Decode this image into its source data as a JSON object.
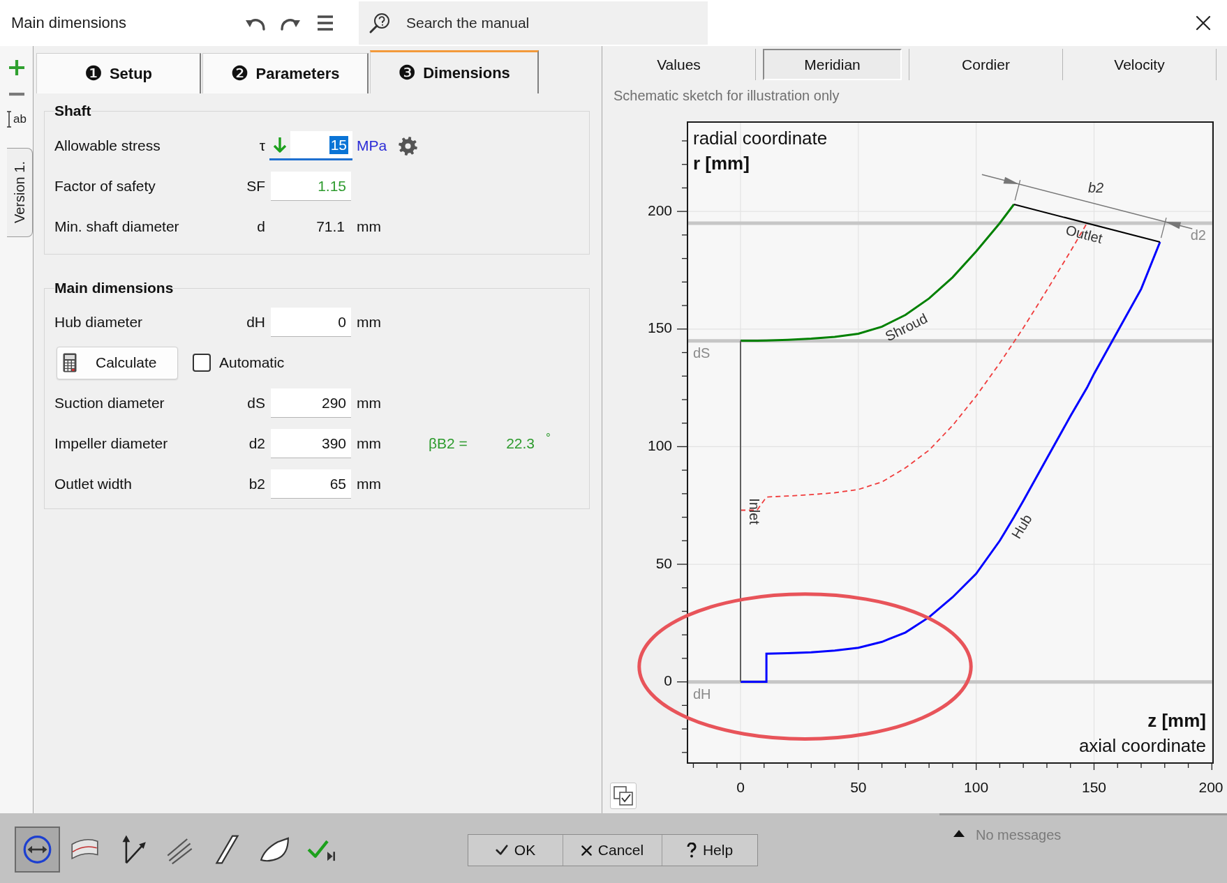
{
  "window": {
    "title": "Main dimensions",
    "search": {
      "placeholder": "Search the manual"
    }
  },
  "side_tools": [
    {
      "kind": "add"
    },
    {
      "kind": "remove"
    },
    {
      "kind": "rename",
      "label": "ab"
    }
  ],
  "version_tab": {
    "label": "Version 1."
  },
  "steps": [
    {
      "number": "❶",
      "label": "Setup",
      "selected": false
    },
    {
      "number": "❷",
      "label": "Parameters",
      "selected": false
    },
    {
      "number": "❸",
      "label": "Dimensions",
      "selected": true
    }
  ],
  "shaft": {
    "title": "Shaft",
    "rows": [
      {
        "kind": "stress",
        "label": "Allowable stress",
        "symbol": "τ",
        "value": "15",
        "unit": "MPa",
        "focused": true
      },
      {
        "kind": "input",
        "label": "Factor of safety",
        "symbol": "SF",
        "value": "1.15",
        "color": "#2e9b2e"
      },
      {
        "kind": "readout",
        "label": "Min. shaft diameter",
        "symbol": "d",
        "value": "71.1",
        "unit": "mm",
        "color": "#111111"
      }
    ]
  },
  "main_dimensions": {
    "title": "Main dimensions",
    "rows": [
      {
        "kind": "input",
        "label": "Hub diameter",
        "symbol": "dH",
        "value": "0",
        "unit": "mm",
        "color": "#111111"
      },
      {
        "kind": "action",
        "button": "Calculate",
        "checkbox": {
          "label": "Automatic",
          "checked": false
        }
      },
      {
        "kind": "input",
        "label": "Suction diameter",
        "symbol": "dS",
        "value": "290",
        "unit": "mm",
        "color": "#111111"
      },
      {
        "kind": "input",
        "label": "Impeller diameter",
        "symbol": "d2",
        "value": "390",
        "unit": "mm",
        "color": "#111111",
        "extra": {
          "label": "βB2 =",
          "value": "22.3",
          "unit": "°"
        }
      },
      {
        "kind": "input",
        "label": "Outlet width",
        "symbol": "b2",
        "value": "65",
        "unit": "mm",
        "color": "#111111"
      }
    ]
  },
  "view": {
    "tabs": [
      {
        "label": "Values",
        "selected": false
      },
      {
        "label": "Meridian",
        "selected": true
      },
      {
        "label": "Cordier",
        "selected": false
      },
      {
        "label": "Velocity",
        "selected": false
      }
    ],
    "note": "Schematic sketch for illustration only",
    "chart": {
      "y_caption": "radial coordinate",
      "x_caption": "axial coordinate",
      "chart_data": {
        "type": "line",
        "xlabel": "z [mm]",
        "ylabel": "r [mm]",
        "x": [
          0,
          7,
          11,
          11,
          20,
          30,
          40,
          50,
          60,
          70,
          80,
          90,
          100,
          110,
          116,
          120,
          130,
          140,
          147,
          150,
          160,
          170,
          178,
          0,
          0,
          116,
          178
        ],
        "series": [
          {
            "name": "Shroud",
            "color": "#008000",
            "line_style": "solid",
            "values": [
              145,
              145,
              145.1,
              145.1,
              145.4,
              145.9,
              146.7,
              148,
              151,
              156,
              163,
              172,
              183,
              195,
              203,
              null,
              null,
              null,
              null,
              null,
              null,
              null,
              null,
              null,
              null,
              null,
              null
            ]
          },
          {
            "name": "Hub",
            "color": "#0000ff",
            "line_style": "solid",
            "values": [
              0,
              0,
              0,
              12,
              12.2,
              12.6,
              13.3,
              14.5,
              17,
              21,
              27.5,
              36,
              46,
              60,
              70,
              77,
              95,
              113,
              125,
              131,
              149,
              167,
              187,
              null,
              null,
              null,
              null
            ]
          },
          {
            "color": "#f03c3c",
            "line_style": "dashed",
            "values": [
              73,
              73,
              78.6,
              78.6,
              79,
              79.6,
              80.4,
              81.8,
              85,
              91,
              98.5,
              109,
              121.5,
              135.5,
              144.5,
              150.5,
              166.5,
              183,
              195,
              null,
              null,
              null,
              null,
              null,
              null,
              null,
              null
            ]
          },
          {
            "name": "Inlet",
            "color": "#606060",
            "line_style": "solid",
            "values": [
              null,
              null,
              null,
              null,
              null,
              null,
              null,
              null,
              null,
              null,
              null,
              null,
              null,
              null,
              null,
              null,
              null,
              null,
              null,
              null,
              null,
              null,
              null,
              0,
              145,
              null,
              null
            ]
          },
          {
            "name": "Outlet",
            "color": "#000000",
            "line_style": "solid",
            "values": [
              null,
              null,
              null,
              null,
              null,
              null,
              null,
              null,
              null,
              null,
              null,
              null,
              null,
              null,
              null,
              null,
              null,
              null,
              null,
              null,
              null,
              null,
              null,
              null,
              null,
              203,
              187
            ]
          }
        ],
        "xlim": [
          -22.5,
          200.5
        ],
        "ylim": [
          -34.5,
          238
        ],
        "xticks": [
          0,
          50,
          100,
          150,
          200
        ],
        "yticks": [
          0,
          50,
          100,
          150,
          200
        ],
        "grid": true,
        "ref_lines": [
          {
            "axis": "y",
            "value": 195,
            "label": "d2"
          },
          {
            "axis": "y",
            "value": 145,
            "label": "dS"
          },
          {
            "axis": "y",
            "value": 0,
            "label": "dH"
          }
        ],
        "annotations": [
          "b2"
        ]
      }
    }
  },
  "toolbar": {
    "tools": [
      {
        "kind": "meridian",
        "selected": true
      },
      {
        "kind": "surface",
        "selected": false
      },
      {
        "kind": "axes",
        "selected": false
      },
      {
        "kind": "hatch",
        "selected": false
      },
      {
        "kind": "sheet",
        "selected": false
      },
      {
        "kind": "profile",
        "selected": false
      },
      {
        "kind": "check",
        "selected": false
      }
    ],
    "buttons": [
      {
        "kind": "ok",
        "label": "OK"
      },
      {
        "kind": "cancel",
        "label": "Cancel"
      },
      {
        "kind": "help",
        "label": "Help"
      }
    ],
    "messages": "No messages"
  }
}
